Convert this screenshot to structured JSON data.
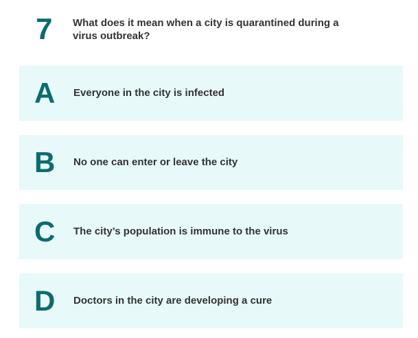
{
  "question": {
    "number": "7",
    "text": "What does it mean when a city is quarantined during a virus outbreak?"
  },
  "options": [
    {
      "letter": "A",
      "text": "Everyone in the city is infected"
    },
    {
      "letter": "B",
      "text": "No one can enter or leave the city"
    },
    {
      "letter": "C",
      "text": "The city’s population is immune to the virus"
    },
    {
      "letter": "D",
      "text": "Doctors in the city are developing a cure"
    }
  ],
  "colors": {
    "accent": "#0d6b6e",
    "option_background": "#e7f9f9",
    "text": "#333333"
  }
}
